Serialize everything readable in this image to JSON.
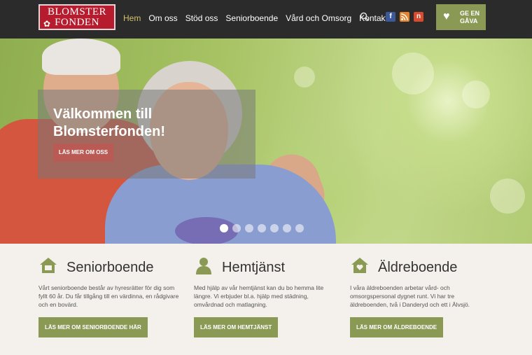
{
  "header": {
    "logo_line1": "BLOMSTER",
    "logo_line2": "FONDEN",
    "nav": [
      "Hem",
      "Om oss",
      "Stöd oss",
      "Seniorboende",
      "Vård och Omsorg",
      "Kontakt"
    ],
    "active_nav": "Hem",
    "social": {
      "facebook": "f",
      "newsletter": "n"
    },
    "gift_button": "GE EN GÅVA"
  },
  "hero": {
    "title": "Välkommen till Blomsterfonden!",
    "button": "LÄS MER OM OSS",
    "slides_count": 7,
    "active_slide": 1
  },
  "columns": [
    {
      "icon": "house-icon",
      "title": "Seniorboende",
      "text": "Vårt seniorboende består av hyresrätter för dig som fyllt 60 år. Du får tillgång till en värdinna, en rådgivare och en bovärd.",
      "button": "LÄS MER OM SENIORBOENDE HÄR"
    },
    {
      "icon": "person-icon",
      "title": "Hemtjänst",
      "text": "Med hjälp av vår hemtjänst kan du bo hemma lite längre. Vi erbjuder bl.a. hjälp med städning, omvårdnad och matlagning.",
      "button": "LÄS MER OM HEMTJÄNST"
    },
    {
      "icon": "heart-house-icon",
      "title": "Äldreboende",
      "text": "I våra äldreboenden arbetar vård- och omsorgspersonal dygnet runt. Vi har tre äldreboenden, två i Danderyd och ett i Älvsjö.",
      "button": "LÄS MER OM ÄLDREBOENDE"
    }
  ],
  "colors": {
    "header_bg": "#2b2b2b",
    "accent_green": "#8a9a55",
    "brand_red": "#b71c2e",
    "active_nav": "#d3c06c",
    "hero_button": "#b95a54"
  }
}
